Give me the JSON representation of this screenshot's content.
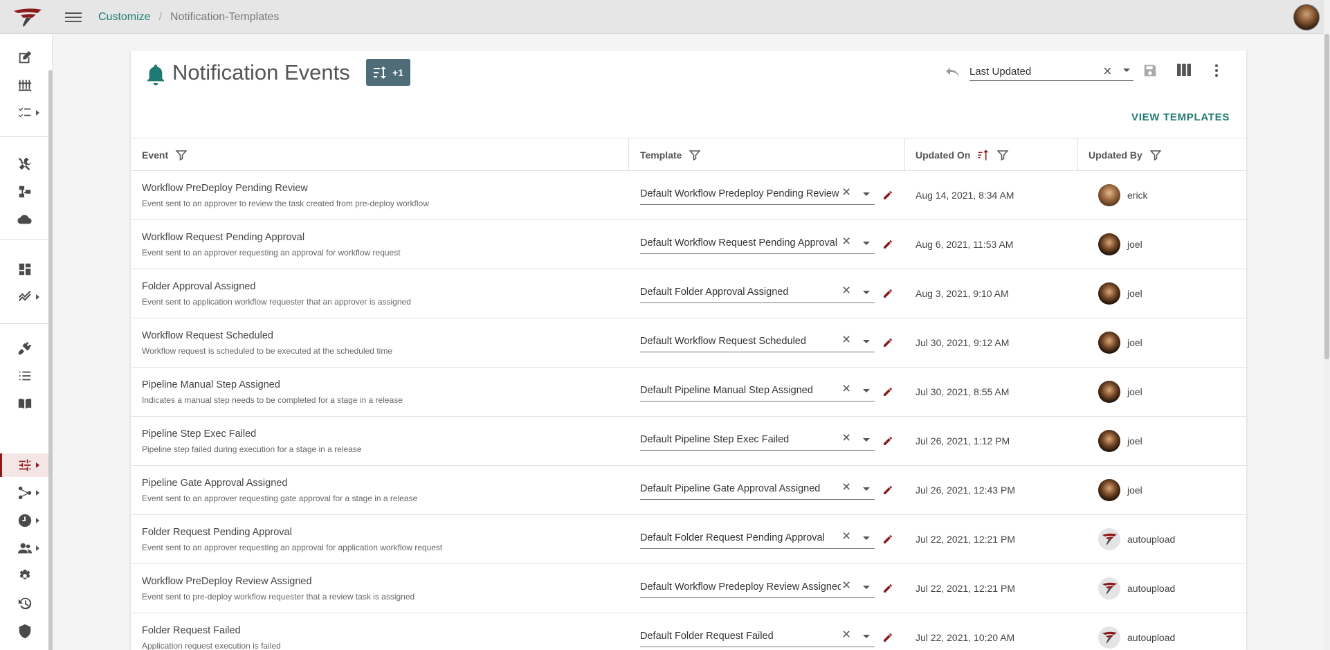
{
  "header": {
    "breadcrumbs": [
      "Customize",
      "Notification-Templates"
    ]
  },
  "page": {
    "title": "Notification Events",
    "sort_chip_label": "+1",
    "sort_field": "Last Updated",
    "view_templates_label": "VIEW TEMPLATES"
  },
  "table": {
    "columns": [
      "Event",
      "Template",
      "Updated On",
      "Updated By"
    ],
    "rows": [
      {
        "event": "Workflow PreDeploy Pending Review",
        "desc": "Event sent to an approver to review the task created from pre-deploy workflow",
        "template": "Default Workflow Predeploy Pending Review",
        "updated_on": "Aug 14, 2021, 8:34 AM",
        "updated_by": "erick",
        "avatar": "erick"
      },
      {
        "event": "Workflow Request Pending Approval",
        "desc": "Event sent to an approver requesting an approval for workflow request",
        "template": "Default Workflow Request Pending Approval",
        "updated_on": "Aug 6, 2021, 11:53 AM",
        "updated_by": "joel",
        "avatar": "joel"
      },
      {
        "event": "Folder Approval Assigned",
        "desc": "Event sent to application workflow requester that an approver is assigned",
        "template": "Default Folder Approval Assigned",
        "updated_on": "Aug 3, 2021, 9:10 AM",
        "updated_by": "joel",
        "avatar": "joel"
      },
      {
        "event": "Workflow Request Scheduled",
        "desc": "Workflow request is scheduled to be executed at the scheduled time",
        "template": "Default Workflow Request Scheduled",
        "updated_on": "Jul 30, 2021, 9:12 AM",
        "updated_by": "joel",
        "avatar": "joel"
      },
      {
        "event": "Pipeline Manual Step Assigned",
        "desc": "Indicates a manual step needs to be completed for a stage in a release",
        "template": "Default Pipeline Manual Step Assigned",
        "updated_on": "Jul 30, 2021, 8:55 AM",
        "updated_by": "joel",
        "avatar": "joel"
      },
      {
        "event": "Pipeline Step Exec Failed",
        "desc": "Pipeline step failed during execution for a stage in a release",
        "template": "Default Pipeline Step Exec Failed",
        "updated_on": "Jul 26, 2021, 1:12 PM",
        "updated_by": "joel",
        "avatar": "joel"
      },
      {
        "event": "Pipeline Gate Approval Assigned",
        "desc": "Event sent to an approver requesting gate approval for a stage in a release",
        "template": "Default Pipeline Gate Approval Assigned",
        "updated_on": "Jul 26, 2021, 12:43 PM",
        "updated_by": "joel",
        "avatar": "joel"
      },
      {
        "event": "Folder Request Pending Approval",
        "desc": "Event sent to an approver requesting an approval for application workflow request",
        "template": "Default Folder Request Pending Approval",
        "updated_on": "Jul 22, 2021, 12:21 PM",
        "updated_by": "autoupload",
        "avatar": "auto"
      },
      {
        "event": "Workflow PreDeploy Review Assigned",
        "desc": "Event sent to pre-deploy workflow requester that a review task is assigned",
        "template": "Default Workflow Predeploy Review Assigned",
        "updated_on": "Jul 22, 2021, 12:21 PM",
        "updated_by": "autoupload",
        "avatar": "auto"
      },
      {
        "event": "Folder Request Failed",
        "desc": "Application request execution is failed",
        "template": "Default Folder Request Failed",
        "updated_on": "Jul 22, 2021, 10:20 AM",
        "updated_by": "autoupload",
        "avatar": "auto"
      }
    ]
  },
  "colors": {
    "accent": "#1e7a73",
    "brand_red": "#8b1a1a",
    "chip": "#4f6d78"
  },
  "icons": {
    "sidebar": [
      "edit-icon",
      "pipelines-icon",
      "checklist-icon",
      "tools-icon",
      "workflow-icon",
      "cloud-icon",
      "dashboard-icon",
      "analytics-icon",
      "plugin-icon",
      "list-icon",
      "book-icon",
      "customize-icon",
      "integration-icon",
      "schedule-icon",
      "users-icon",
      "settings-icon",
      "history-icon",
      "security-icon",
      "approvals-icon"
    ]
  }
}
